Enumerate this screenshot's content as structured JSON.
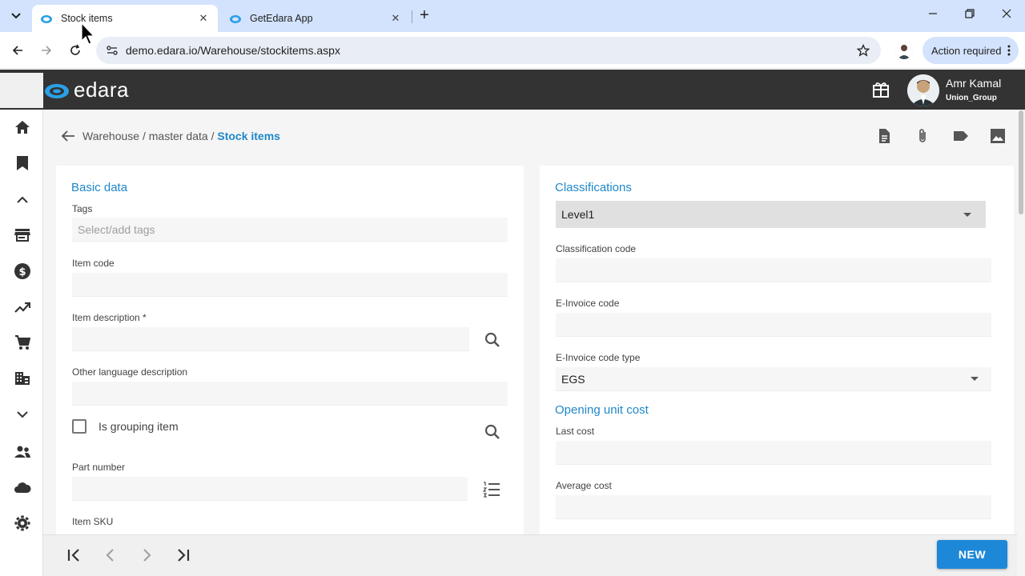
{
  "browser": {
    "tabs": [
      {
        "title": "Stock items",
        "active": true
      },
      {
        "title": "GetEdara App",
        "active": false
      }
    ],
    "url": "demo.edara.io/Warehouse/stockitems.aspx",
    "action_required": "Action required"
  },
  "header": {
    "logo": "edara",
    "user_name": "Amr Kamal",
    "user_group": "Union_Group"
  },
  "breadcrumb": {
    "part1": "Warehouse",
    "sep1": " / ",
    "part2": "master data",
    "sep2": " / ",
    "current": "Stock items"
  },
  "basic": {
    "title": "Basic data",
    "tags_label": "Tags",
    "tags_placeholder": "Select/add tags",
    "item_code_label": "Item code",
    "item_desc_label": "Item description *",
    "other_lang_label": "Other language description",
    "grouping_label": "Is grouping item",
    "part_number_label": "Part number",
    "sku_label": "Item SKU"
  },
  "classifications": {
    "title": "Classifications",
    "level_value": "Level1",
    "class_code_label": "Classification code",
    "einvoice_code_label": "E-Invoice code",
    "einvoice_type_label": "E-Invoice code type",
    "einvoice_type_value": "EGS"
  },
  "opening": {
    "title": "Opening unit cost",
    "last_cost_label": "Last cost",
    "avg_cost_label": "Average cost"
  },
  "footer": {
    "new_label": "NEW"
  },
  "colors": {
    "accent": "#1e88c8",
    "header_bg": "#333333",
    "button_bg": "#1e88d8"
  }
}
